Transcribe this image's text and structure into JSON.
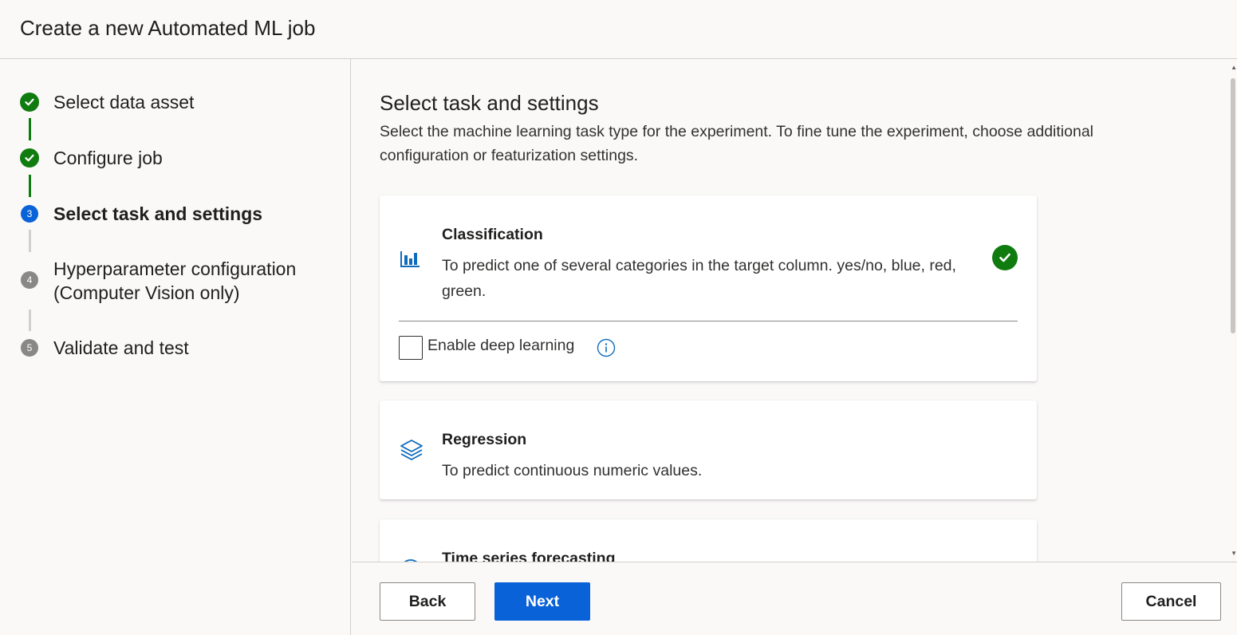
{
  "header": {
    "title": "Create a new Automated ML job"
  },
  "steps": [
    {
      "label": "Select data asset",
      "status": "complete",
      "icon": "check-icon"
    },
    {
      "label": "Configure job",
      "status": "complete",
      "icon": "check-icon"
    },
    {
      "number": "3",
      "label": "Select task and settings",
      "status": "current"
    },
    {
      "number": "4",
      "label_line1": "Hyperparameter configuration",
      "label_line2": "(Computer Vision only)",
      "status": "pending"
    },
    {
      "number": "5",
      "label": "Validate and test",
      "status": "pending"
    }
  ],
  "main": {
    "title": "Select task and settings",
    "description": "Select the machine learning task type for the experiment. To fine tune the experiment, choose additional configuration or featurization settings.",
    "tasks": [
      {
        "title": "Classification",
        "description": "To predict one of several categories in the target column. yes/no, blue, red, green.",
        "icon": "bar-chart-icon",
        "selected": true,
        "option": {
          "label": "Enable deep learning",
          "checked": false,
          "info_icon": "info-icon"
        }
      },
      {
        "title": "Regression",
        "description": "To predict continuous numeric values.",
        "icon": "layers-icon",
        "selected": false
      },
      {
        "title": "Time series forecasting",
        "icon": "clock-icon",
        "selected": false
      }
    ]
  },
  "footer": {
    "back": "Back",
    "next": "Next",
    "cancel": "Cancel"
  },
  "colors": {
    "primary": "#0a62d8",
    "success": "#107c10",
    "pending": "#8a8886",
    "icon": "#0f6cbd"
  }
}
